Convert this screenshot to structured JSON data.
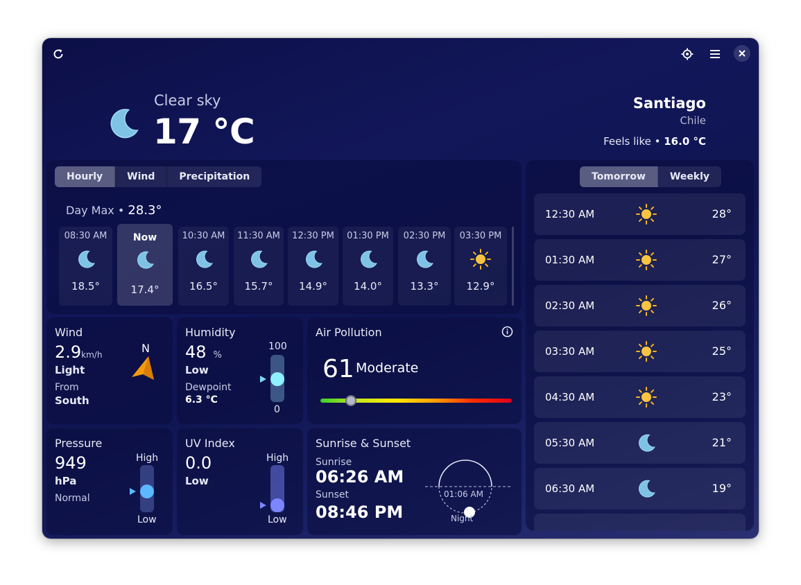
{
  "header": {
    "refresh_icon": "refresh-icon",
    "locate_icon": "crosshair-icon",
    "menu_icon": "hamburger-menu-icon",
    "close_icon": "close-icon"
  },
  "current": {
    "condition": "Clear sky",
    "temperature": "17 °C",
    "icon": "moon-icon",
    "city": "Santiago",
    "country": "Chile",
    "feels_like_label": "Feels like •",
    "feels_like_value": "16.0 °C"
  },
  "hourly_panel": {
    "tabs": [
      "Hourly",
      "Wind",
      "Precipitation"
    ],
    "active_tab": "Hourly",
    "day_max_label": "Day Max •",
    "day_max_value": "28.3°",
    "items": [
      {
        "time": "08:30 AM",
        "icon": "moon-icon",
        "temp": "18.5°"
      },
      {
        "time": "Now",
        "icon": "moon-icon",
        "temp": "17.4°"
      },
      {
        "time": "10:30 AM",
        "icon": "moon-icon",
        "temp": "16.5°"
      },
      {
        "time": "11:30 AM",
        "icon": "moon-icon",
        "temp": "15.7°"
      },
      {
        "time": "12:30 PM",
        "icon": "moon-icon",
        "temp": "14.9°"
      },
      {
        "time": "01:30 PM",
        "icon": "moon-icon",
        "temp": "14.0°"
      },
      {
        "time": "02:30 PM",
        "icon": "moon-icon",
        "temp": "13.3°"
      },
      {
        "time": "03:30 PM",
        "icon": "sun-icon",
        "temp": "12.9°"
      }
    ]
  },
  "wind": {
    "title": "Wind",
    "speed": "2.9",
    "unit": "km/h",
    "desc": "Light",
    "from_label": "From",
    "from": "South",
    "direction": "N",
    "icon": "navigation-arrow-icon"
  },
  "humidity": {
    "title": "Humidity",
    "value": "48",
    "unit": "%",
    "desc": "Low",
    "dewpoint_label": "Dewpoint",
    "dewpoint": "6.3 °C",
    "max": "100",
    "min": "0",
    "level": 0.48
  },
  "air_pollution": {
    "title": "Air Pollution",
    "value": "61",
    "desc": "Moderate",
    "info_icon": "info-icon",
    "level": 0.16
  },
  "pressure": {
    "title": "Pressure",
    "value": "949",
    "unit": "hPa",
    "desc": "Normal",
    "high": "High",
    "low": "Low",
    "level": 0.42
  },
  "uv": {
    "title": "UV Index",
    "value": "0.0",
    "desc": "Low",
    "high": "High",
    "low": "Low",
    "level": 0.0
  },
  "sun": {
    "title": "Sunrise & Sunset",
    "sunrise_label": "Sunrise",
    "sunrise": "06:26 AM",
    "sunset_label": "Sunset",
    "sunset": "08:46 PM",
    "dial_time": "01:06 AM",
    "dial_label": "Night"
  },
  "forecast": {
    "tabs": [
      "Tomorrow",
      "Weekly"
    ],
    "active_tab": "Tomorrow",
    "items": [
      {
        "time": "12:30 AM",
        "icon": "sun-icon",
        "temp": "28°"
      },
      {
        "time": "01:30 AM",
        "icon": "sun-icon",
        "temp": "27°"
      },
      {
        "time": "02:30 AM",
        "icon": "sun-icon",
        "temp": "26°"
      },
      {
        "time": "03:30 AM",
        "icon": "sun-icon",
        "temp": "25°"
      },
      {
        "time": "04:30 AM",
        "icon": "sun-icon",
        "temp": "23°"
      },
      {
        "time": "05:30 AM",
        "icon": "moon-icon",
        "temp": "21°"
      },
      {
        "time": "06:30 AM",
        "icon": "moon-icon",
        "temp": "19°"
      }
    ]
  },
  "colors": {
    "moon": "#7ec3e6",
    "sun": "#f6b51e",
    "accent_arrow": "#f59a0c",
    "uv_knob": "#7b86ff",
    "humidity_knob": "#8ff0ff",
    "pressure_knob": "#5cb8ff"
  }
}
